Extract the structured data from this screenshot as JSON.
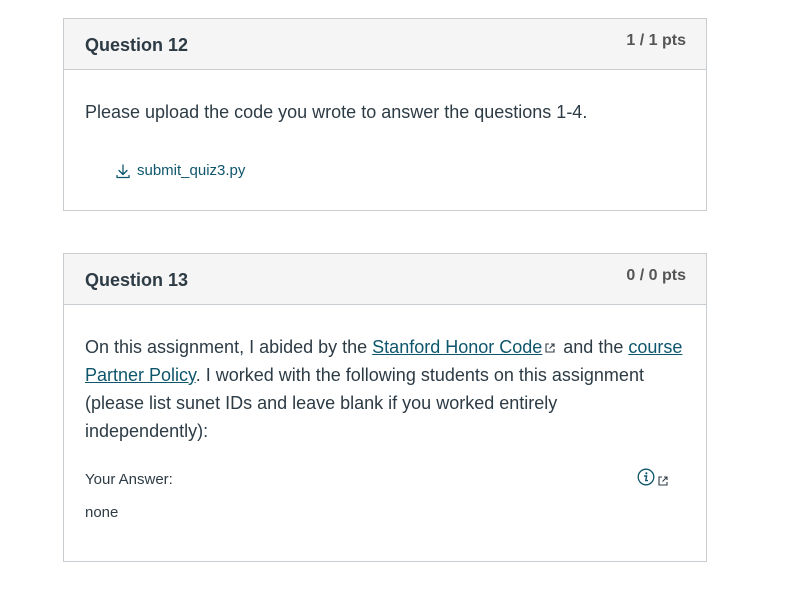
{
  "q12": {
    "title": "Question 12",
    "points": "1 / 1 pts",
    "text": "Please upload the code you wrote to answer the questions 1-4.",
    "file_name": "submit_quiz3.py",
    "file_icon": "download-icon"
  },
  "q13": {
    "title": "Question 13",
    "points": "0 / 0 pts",
    "text_before_link1": "On this assignment, I abided by the ",
    "link1": "Stanford Honor Code",
    "text_between": " and the ",
    "link2": "course Partner Policy",
    "text_after": ". I worked with the following students on this assignment (please list sunet IDs and leave blank if you worked entirely independently):",
    "answer_label": "Your Answer:",
    "answer_value": "none",
    "info_icon": "info-icon",
    "external_icon": "external-link-icon"
  },
  "colors": {
    "link": "#0e566c",
    "text": "#2d3b45",
    "header_bg": "#f5f5f5",
    "border": "#c7cdd1"
  }
}
